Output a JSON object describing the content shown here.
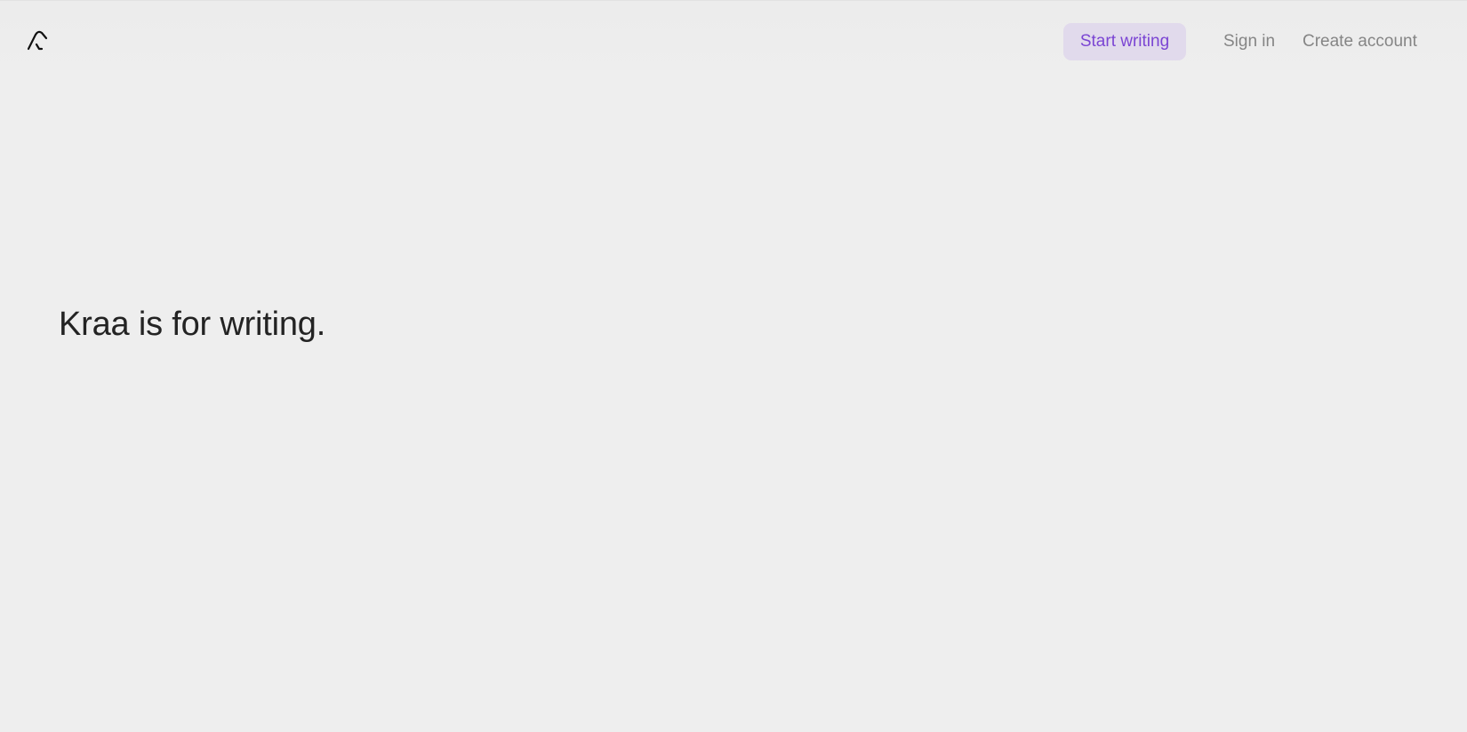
{
  "header": {
    "logo_icon": "kraa-logo-icon",
    "start_writing_label": "Start writing",
    "sign_in_label": "Sign in",
    "create_account_label": "Create account"
  },
  "main": {
    "headline": "Kraa is for writing."
  },
  "colors": {
    "background": "#eeeeee",
    "accent": "#7b45d3",
    "accent_bg": "#e1daec",
    "link": "#858585",
    "text": "#232323"
  }
}
